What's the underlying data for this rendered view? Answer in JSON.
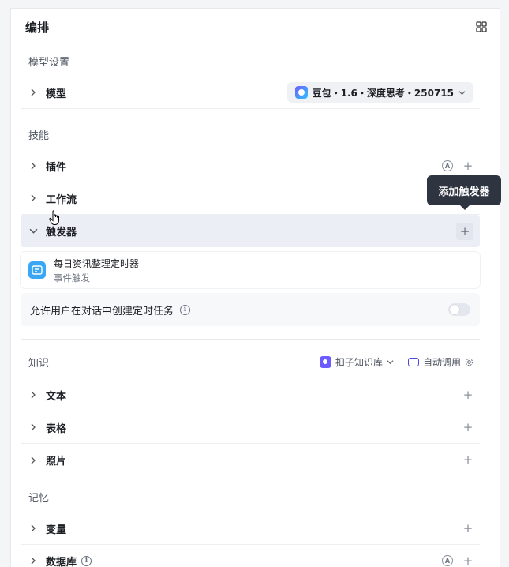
{
  "header": {
    "title": "编排",
    "grid_icon": "layout-grid-icon"
  },
  "model_settings": {
    "label": "模型设置",
    "row_label": "模型",
    "selected_model": "豆包・1.6・深度思考・250715"
  },
  "skills": {
    "label": "技能",
    "items": [
      {
        "label": "插件"
      },
      {
        "label": "工作流"
      },
      {
        "label": "触发器"
      }
    ],
    "trigger": {
      "name": "每日资讯整理定时器",
      "type": "事件触发"
    },
    "allow_option": {
      "label": "允许用户在对话中创建定时任务",
      "enabled": false
    }
  },
  "tooltip": {
    "text": "添加触发器"
  },
  "knowledge": {
    "label": "知识",
    "source": "扣子知识库",
    "mode": "自动调用",
    "items": [
      {
        "label": "文本"
      },
      {
        "label": "表格"
      },
      {
        "label": "照片"
      }
    ]
  },
  "memory": {
    "label": "记忆",
    "items": [
      {
        "label": "变量"
      },
      {
        "label": "数据库"
      }
    ]
  },
  "colors": {
    "accent": "#4f46e5",
    "tooltip_bg": "#2e3440"
  }
}
